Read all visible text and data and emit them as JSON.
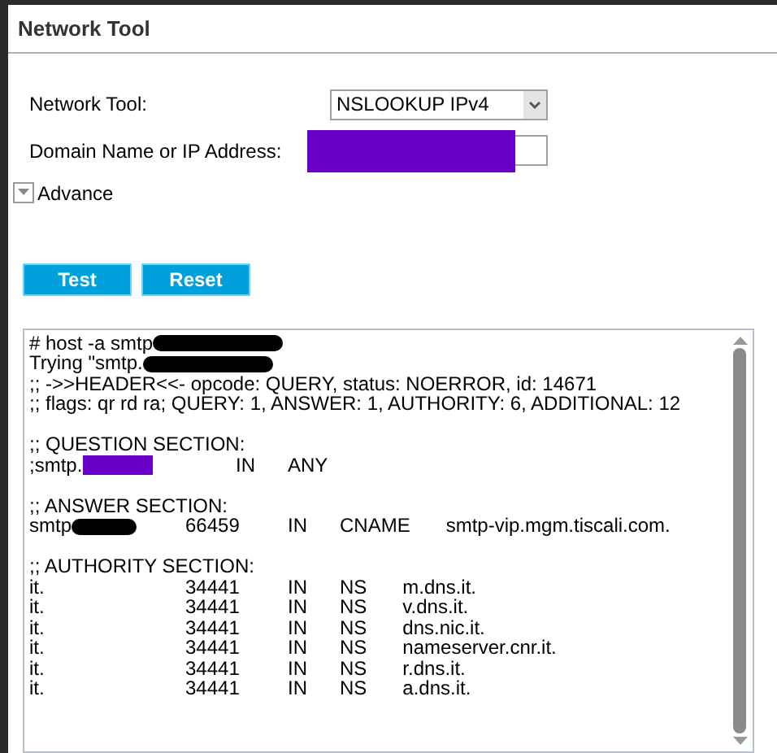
{
  "panel": {
    "title": "Network Tool"
  },
  "form": {
    "tool_label": "Network Tool:",
    "tool_value": "NSLOOKUP IPv4",
    "address_label": "Domain Name or IP Address:",
    "address_redacted": true,
    "advance": {
      "label": "Advance",
      "expanded": false
    }
  },
  "buttons": [
    "Test",
    "Reset"
  ],
  "output": [
    {
      "kind": "text",
      "text": "# host -a smtp",
      "redacted": true
    },
    {
      "kind": "text",
      "text": "Trying \"smtp.",
      "redacted": true
    },
    {
      "kind": "text",
      "text": ";; ->>HEADER<<- opcode: QUERY, status: NOERROR, id: 14671",
      "redacted": false
    },
    {
      "kind": "text",
      "text": ";; flags: qr rd ra; QUERY: 1, ANSWER: 1, AUTHORITY: 6, ADDITIONAL: 12",
      "redacted": false
    },
    {
      "kind": "blank"
    },
    {
      "kind": "text",
      "text": ";; QUESTION SECTION:",
      "redacted": false
    },
    {
      "kind": "question",
      "name": ";smtp.",
      "redacted": true,
      "class": "IN",
      "type": "ANY"
    },
    {
      "kind": "blank"
    },
    {
      "kind": "text",
      "text": ";; ANSWER SECTION:",
      "redacted": false
    },
    {
      "kind": "record",
      "name": "smtp",
      "redacted": true,
      "ttl": "66459",
      "class": "IN",
      "type": "CNAME",
      "value": "smtp-vip.mgm.tiscali.com."
    },
    {
      "kind": "blank"
    },
    {
      "kind": "text",
      "text": ";; AUTHORITY SECTION:",
      "redacted": false
    },
    {
      "kind": "record",
      "name": "it.",
      "redacted": false,
      "ttl": "34441",
      "class": "IN",
      "type": "NS",
      "value": "m.dns.it."
    },
    {
      "kind": "record",
      "name": "it.",
      "redacted": false,
      "ttl": "34441",
      "class": "IN",
      "type": "NS",
      "value": "v.dns.it."
    },
    {
      "kind": "record",
      "name": "it.",
      "redacted": false,
      "ttl": "34441",
      "class": "IN",
      "type": "NS",
      "value": "dns.nic.it."
    },
    {
      "kind": "record",
      "name": "it.",
      "redacted": false,
      "ttl": "34441",
      "class": "IN",
      "type": "NS",
      "value": "nameserver.cnr.it."
    },
    {
      "kind": "record",
      "name": "it.",
      "redacted": false,
      "ttl": "34441",
      "class": "IN",
      "type": "NS",
      "value": "r.dns.it."
    },
    {
      "kind": "record",
      "name": "it.",
      "redacted": false,
      "ttl": "34441",
      "class": "IN",
      "type": "NS",
      "value": "a.dns.it."
    }
  ]
}
